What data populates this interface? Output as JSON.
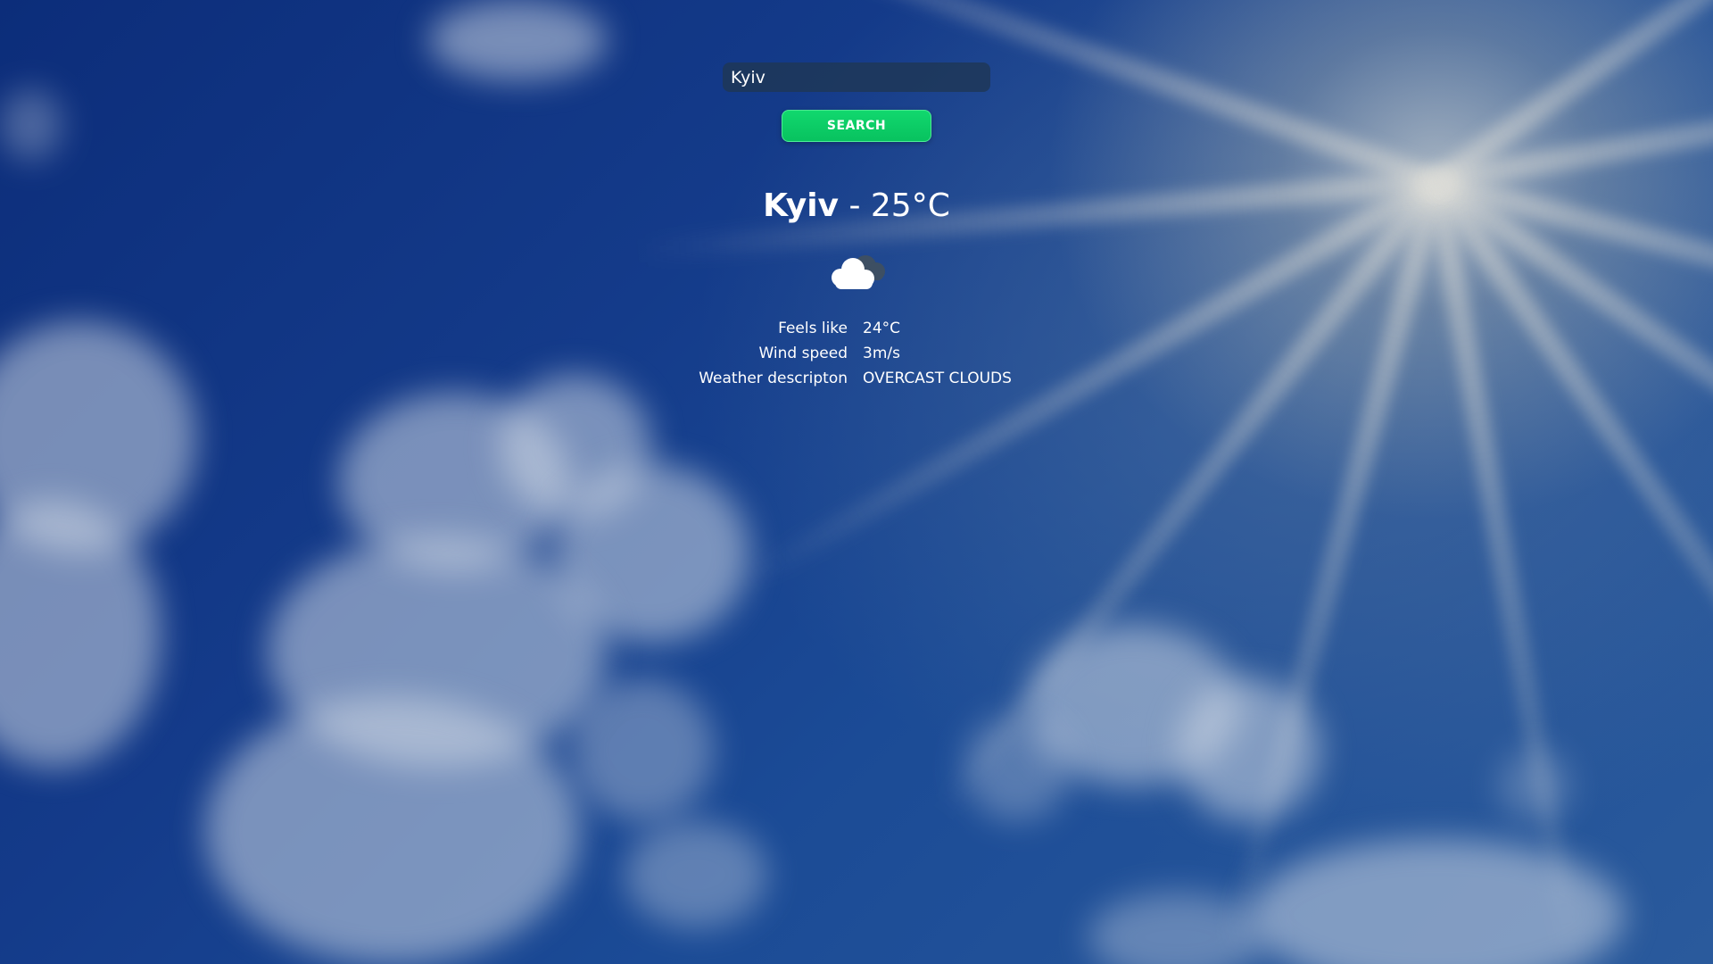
{
  "search": {
    "value": "Kyiv",
    "button_label": "SEARCH"
  },
  "weather": {
    "city": "Kyiv",
    "separator": " - ",
    "temperature": "25°C",
    "icon": "overcast-clouds-icon",
    "details": [
      {
        "label": "Feels like",
        "value": "24°C"
      },
      {
        "label": "Wind speed",
        "value": "3m/s"
      },
      {
        "label": "Weather descripton",
        "value": "OVERCAST CLOUDS"
      }
    ]
  },
  "colors": {
    "search_button": "#0ccf66",
    "search_input_bg": "#1e3755",
    "text": "#ffffff"
  }
}
